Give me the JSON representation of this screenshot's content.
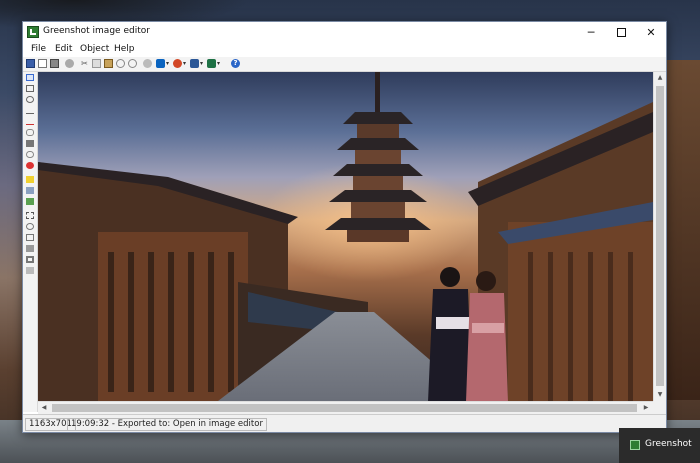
{
  "window": {
    "title": "Greenshot image editor",
    "minimize_glyph": "─",
    "close_glyph": "✕"
  },
  "menu": {
    "items": [
      "File",
      "Edit",
      "Object",
      "Help"
    ]
  },
  "toolbar": {
    "icons": [
      "save-icon",
      "new-icon",
      "print-icon",
      "delete-icon",
      "cut-icon",
      "copy-icon",
      "paste-icon",
      "undo-icon",
      "redo-icon",
      "clipboard-icon",
      "outlook-icon",
      "powerpoint-icon",
      "word-icon",
      "excel-icon",
      "help-icon"
    ],
    "cut_glyph": "✂",
    "dropdown_glyph": "▾",
    "help_glyph": "?"
  },
  "left_tools": {
    "icons": [
      "cursor-icon",
      "rectangle-icon",
      "ellipse-icon",
      "line-icon",
      "arrow-icon",
      "freehand-icon",
      "text-icon",
      "speechbubble-icon",
      "counter-icon",
      "highlight-icon",
      "obfuscate-icon",
      "image-icon",
      "crop-icon",
      "rotate-icon",
      "resize-icon",
      "torn-edge-icon",
      "border-icon",
      "grayscale-icon"
    ]
  },
  "scrollbars": {
    "up_glyph": "▲",
    "down_glyph": "▼",
    "left_glyph": "◀",
    "right_glyph": "▶"
  },
  "status": {
    "dimensions": "1163x701",
    "message": "19:09:32 - Exported to: Open in image editor"
  },
  "notification": {
    "app_name": "Greenshot"
  },
  "colors": {
    "app_accent": "#2e7d32",
    "window_border": "#7a8aa4",
    "statusbar_bg": "#f0f0f0"
  }
}
